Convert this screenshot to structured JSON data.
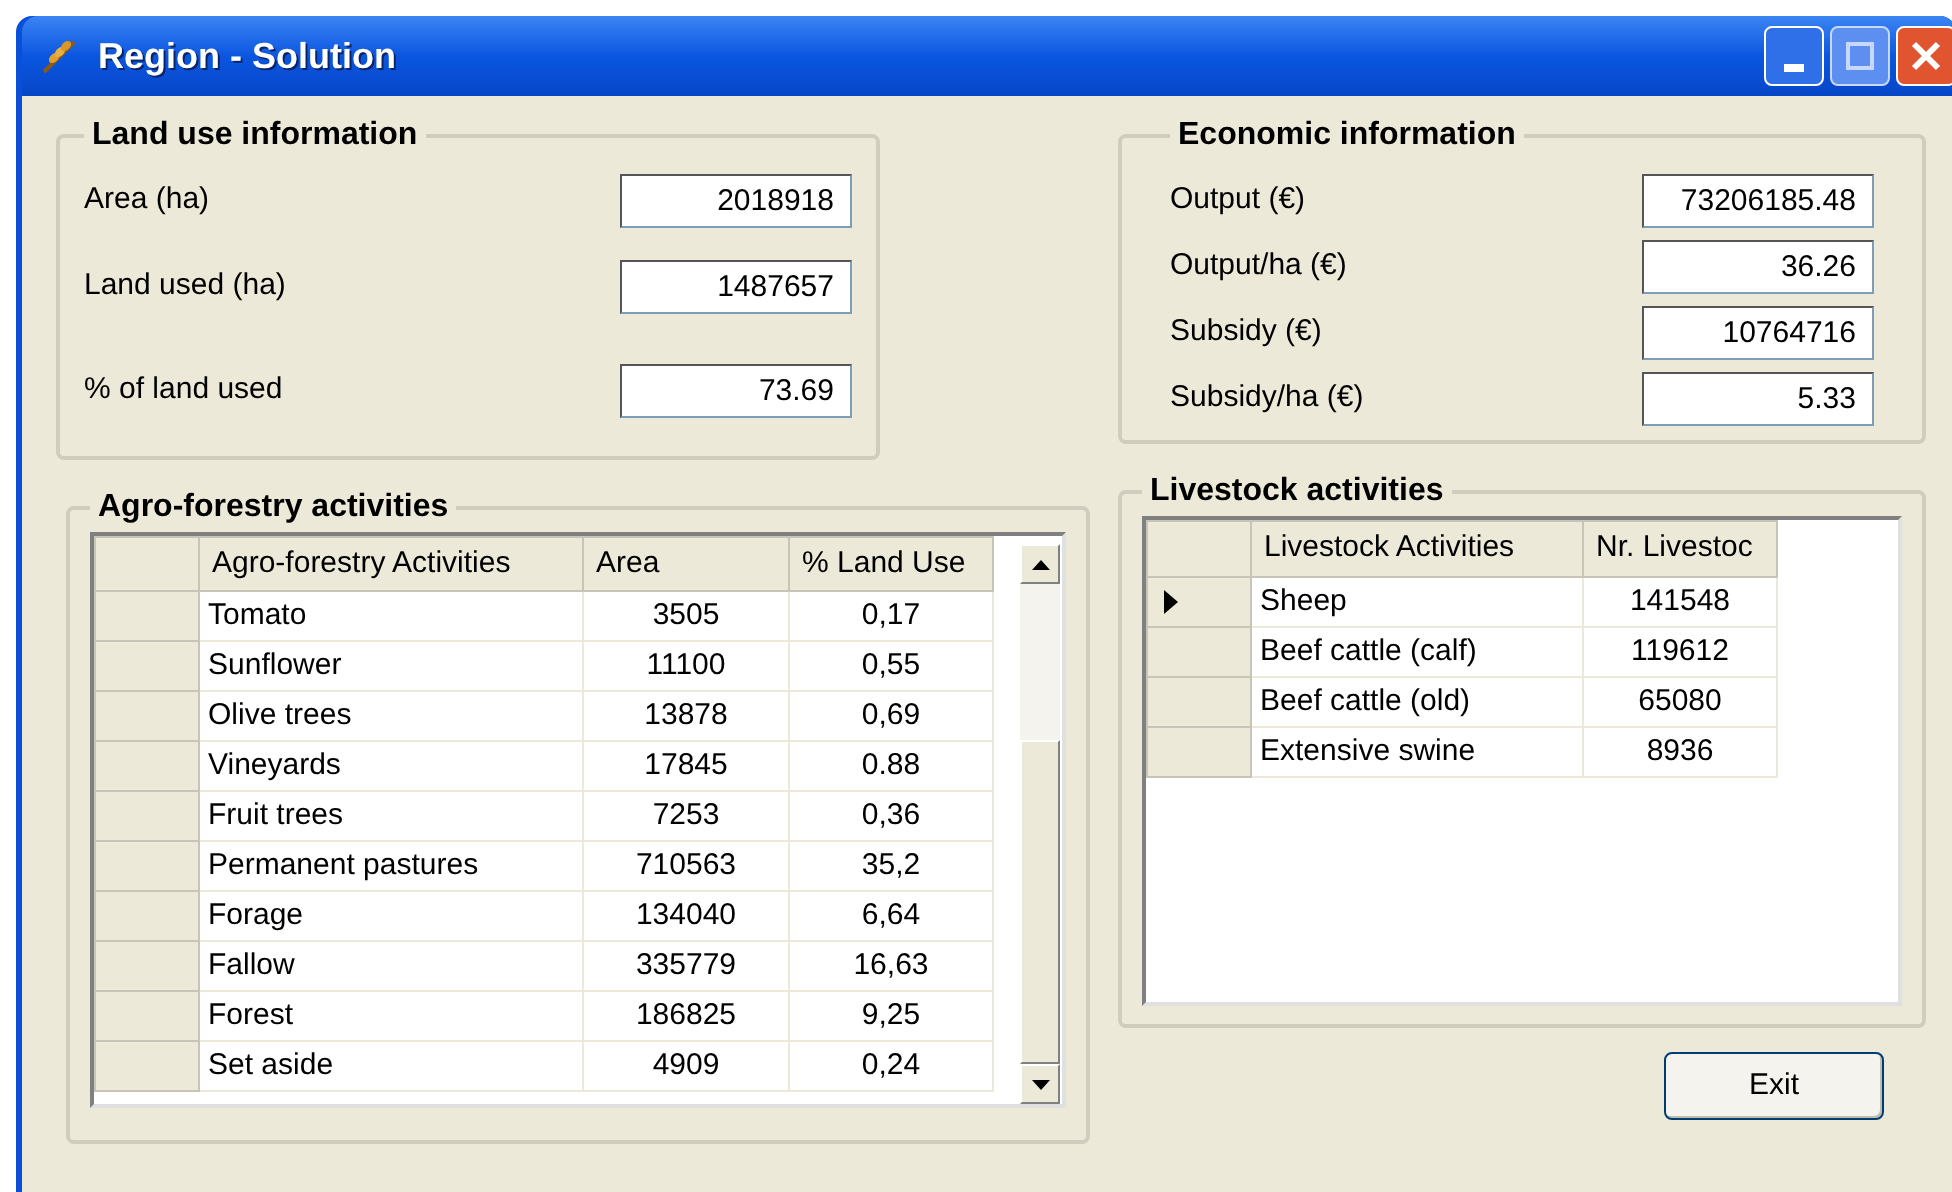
{
  "window": {
    "title": "Region - Solution"
  },
  "land_use": {
    "title": "Land use information",
    "fields": [
      {
        "label": "Area (ha)",
        "value": "2018918"
      },
      {
        "label": "Land used (ha)",
        "value": "1487657"
      },
      {
        "label": "% of land used",
        "value": "73.69"
      }
    ]
  },
  "economic": {
    "title": "Economic information",
    "fields": [
      {
        "label": "Output (€)",
        "value": "73206185.48"
      },
      {
        "label": "Output/ha (€)",
        "value": "36.26"
      },
      {
        "label": "Subsidy (€)",
        "value": "10764716"
      },
      {
        "label": "Subsidy/ha (€)",
        "value": "5.33"
      }
    ]
  },
  "agro": {
    "title": "Agro-forestry activities",
    "columns": [
      "Agro-forestry Activities",
      "Area",
      "% Land Use"
    ],
    "rows": [
      [
        "Tomato",
        "3505",
        "0,17"
      ],
      [
        "Sunflower",
        "11100",
        "0,55"
      ],
      [
        "Olive trees",
        "13878",
        "0,69"
      ],
      [
        "Vineyards",
        "17845",
        "0.88"
      ],
      [
        "Fruit trees",
        "7253",
        "0,36"
      ],
      [
        "Permanent pastures",
        "710563",
        "35,2"
      ],
      [
        "Forage",
        "134040",
        "6,64"
      ],
      [
        "Fallow",
        "335779",
        "16,63"
      ],
      [
        "Forest",
        "186825",
        "9,25"
      ],
      [
        "Set aside",
        "4909",
        "0,24"
      ]
    ]
  },
  "livestock": {
    "title": "Livestock activities",
    "columns": [
      "Livestock Activities",
      "Nr. Livestoc"
    ],
    "rows": [
      {
        "cells": [
          "Sheep",
          "141548"
        ],
        "selected": true
      },
      {
        "cells": [
          "Beef cattle (calf)",
          "119612"
        ],
        "selected": false
      },
      {
        "cells": [
          "Beef cattle (old)",
          "65080"
        ],
        "selected": false
      },
      {
        "cells": [
          "Extensive swine",
          "8936"
        ],
        "selected": false
      }
    ]
  },
  "buttons": [
    "Exit"
  ]
}
